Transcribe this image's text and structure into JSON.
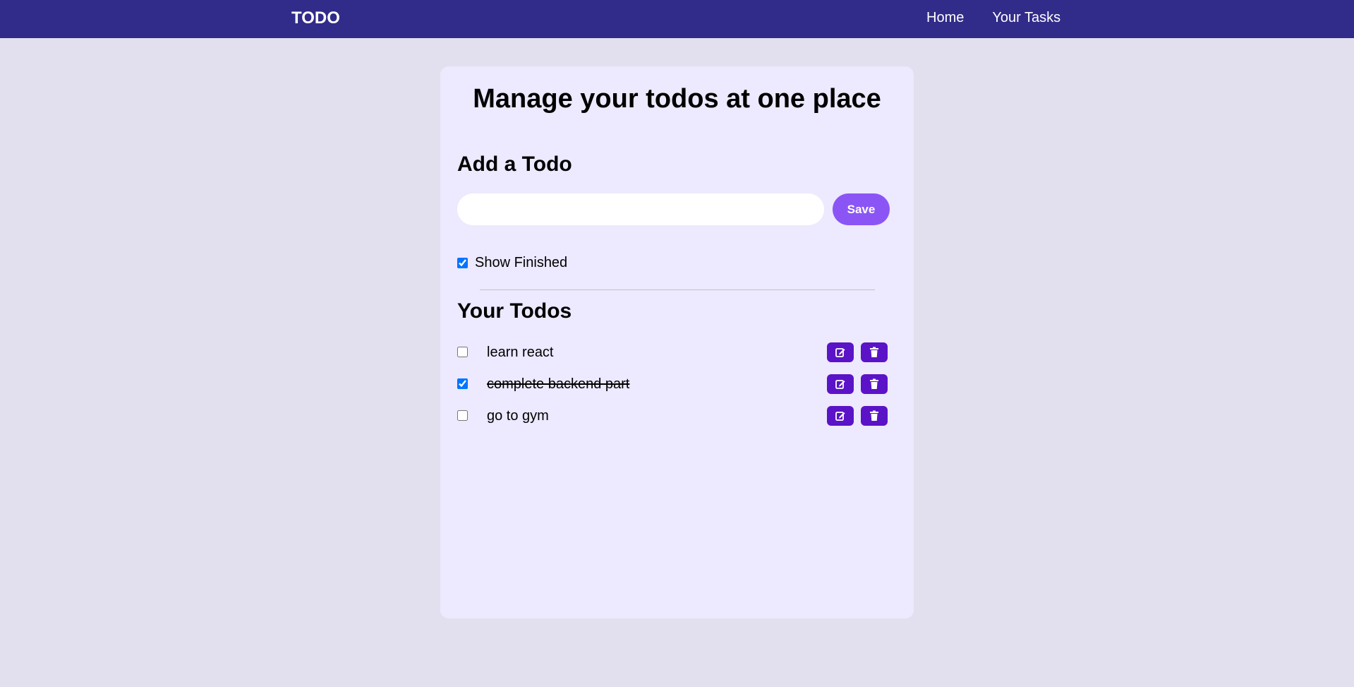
{
  "navbar": {
    "brand": "TODO",
    "links": [
      "Home",
      "Your Tasks"
    ]
  },
  "main": {
    "title": "Manage your todos at one place",
    "add_heading": "Add a Todo",
    "input": {
      "value": "",
      "placeholder": ""
    },
    "save_label": "Save",
    "show_finished": {
      "label": "Show Finished",
      "checked": true
    },
    "todos_heading": "Your Todos",
    "todos": [
      {
        "text": "learn react",
        "completed": false
      },
      {
        "text": "complete backend part",
        "completed": true
      },
      {
        "text": "go to gym",
        "completed": false
      }
    ],
    "row_actions": {
      "edit_icon": "edit-icon",
      "delete_icon": "trash-icon"
    }
  },
  "colors": {
    "navbar": "#312b89",
    "page_bg": "#e2e0ee",
    "card_bg": "#ede9fe",
    "save_button": "#8b55f6",
    "action_button": "#5b13c7"
  }
}
